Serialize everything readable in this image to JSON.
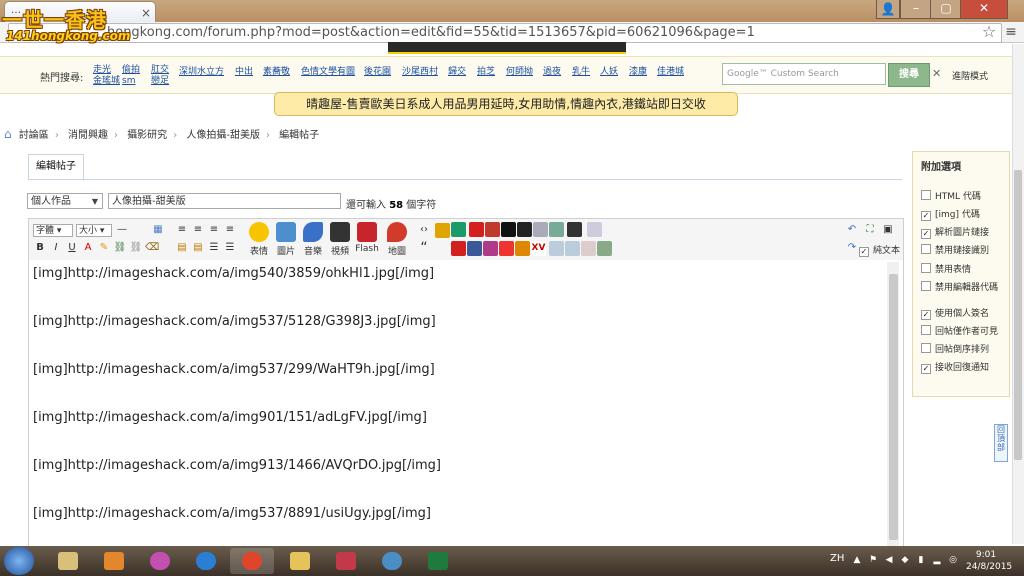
{
  "browser": {
    "tab_title": "…",
    "url": "hongkong.com/forum.php?mod=post&action=edit&fid=55&tid=1513657&pid=60621096&page=1",
    "win_min": "–",
    "win_max": "▢",
    "win_close": "✕"
  },
  "logo": {
    "line1": "一世一香港",
    "line2": "141hongkong.com"
  },
  "hot_search": {
    "label": "熱門搜尋:",
    "links": [
      {
        "text": "走光",
        "sub": "金瑤城"
      },
      {
        "text": "偷拍",
        "sub": "sm"
      },
      {
        "text": "肛交",
        "sub": "戀足"
      },
      {
        "text": "深圳水立方"
      },
      {
        "text": "中出"
      },
      {
        "text": "素蕎敬"
      },
      {
        "text": "色情文學有圖"
      },
      {
        "text": "後花園"
      },
      {
        "text": "沙尾西村"
      },
      {
        "text": "歸交"
      },
      {
        "text": "拍芝"
      },
      {
        "text": "何師拗"
      },
      {
        "text": "過夜"
      },
      {
        "text": "乳牛"
      },
      {
        "text": "人妖"
      },
      {
        "text": "漆康"
      },
      {
        "text": "佳港城"
      }
    ],
    "search_placeholder": "Google™ Custom Search",
    "search_button": "搜尋",
    "close": "✕",
    "advanced": "進階模式"
  },
  "notice": "晴趣屋-售賣歐美日系成人用品男用延時,女用助情,情趣內衣,港鐵站即日交收",
  "breadcrumb": [
    "討論區",
    "消閒興趣",
    "攝影研究",
    "人像拍攝-甜美版",
    "編輯帖子"
  ],
  "editor_tab": "編輯帖子",
  "subject": {
    "category": "個人作品",
    "title": "人像拍攝-甜美版",
    "count_prefix": "還可輸入",
    "count_value": "58",
    "count_suffix": "個字符"
  },
  "toolbar": {
    "font_label": "字體",
    "size_label": "大小",
    "emoticon": "表情",
    "image": "圖片",
    "audio": "音樂",
    "video": "視頻",
    "flash": "Flash",
    "map": "地圖",
    "plain_text": "純文本"
  },
  "editor_lines": [
    "[img]http://imageshack.com/a/img540/3859/ohkHl1.jpg[/img]",
    "[img]http://imageshack.com/a/img537/5128/G398J3.jpg[/img]",
    "[img]http://imageshack.com/a/img537/299/WaHT9h.jpg[/img]",
    "[img]http://imageshack.com/a/img901/151/adLgFV.jpg[/img]",
    "[img]http://imageshack.com/a/img913/1466/AVQrDO.jpg[/img]",
    "[img]http://imageshack.com/a/img537/8891/usiUgy.jpg[/img]"
  ],
  "options": {
    "title": "附加選項",
    "items": [
      {
        "label": "HTML 代碼",
        "checked": false
      },
      {
        "label": "[img] 代碼",
        "checked": true
      },
      {
        "label": "解析圖片鏈接",
        "checked": true
      },
      {
        "label": "禁用鏈接識別",
        "checked": false
      },
      {
        "label": "禁用表情",
        "checked": false
      },
      {
        "label": "禁用編輯器代碼",
        "checked": false
      },
      {
        "label": "使用個人簽名",
        "checked": true
      },
      {
        "label": "回帖僅作者可見",
        "checked": false
      },
      {
        "label": "回帖倒序排列",
        "checked": false
      },
      {
        "label": "接收回復通知",
        "checked": true
      }
    ]
  },
  "back_top": "回頂部",
  "taskbar": {
    "lang": "ZH",
    "time": "9:01",
    "date": "24/8/2015"
  }
}
